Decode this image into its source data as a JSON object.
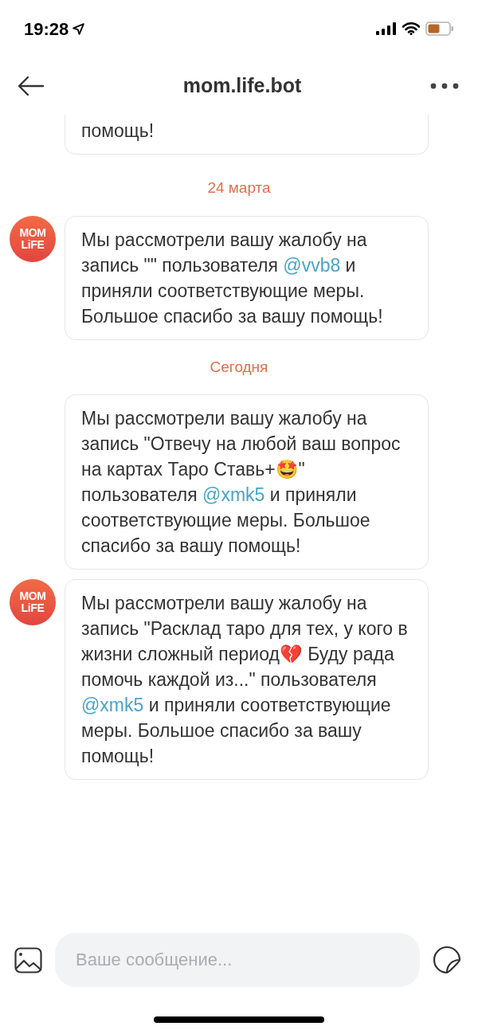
{
  "status_bar": {
    "time": "19:28"
  },
  "header": {
    "title": "mom.life.bot"
  },
  "feed": [
    {
      "kind": "message",
      "cut_top": true,
      "parts": [
        {
          "text": "помощь!",
          "mention": false
        }
      ]
    },
    {
      "kind": "date",
      "text": "24 марта"
    },
    {
      "kind": "message",
      "avatar": {
        "lines": [
          "MOM",
          "LiFE"
        ]
      },
      "parts": [
        {
          "text": "Мы рассмотрели вашу жалобу на запись \"\" пользователя ",
          "mention": false
        },
        {
          "text": "@vvb8",
          "mention": true
        },
        {
          "text": " и приняли соответствующие меры. Большое спасибо за вашу помощь!",
          "mention": false
        }
      ]
    },
    {
      "kind": "date",
      "text": "Сегодня"
    },
    {
      "kind": "message",
      "parts": [
        {
          "text": "Мы рассмотрели вашу жалобу на запись \"Отвечу на любой ваш вопрос на картах Таро Ставь+🤩\" пользователя ",
          "mention": false
        },
        {
          "text": "@xmk5",
          "mention": true
        },
        {
          "text": " и приняли соответствующие меры. Большое спасибо за вашу помощь!",
          "mention": false
        }
      ]
    },
    {
      "kind": "message",
      "avatar": {
        "lines": [
          "MOM",
          "LiFE"
        ]
      },
      "parts": [
        {
          "text": "Мы рассмотрели вашу жалобу на запись \"Расклад таро для тех, у кого в жизни сложный период💔 Буду рада помочь каждой из...\" пользователя ",
          "mention": false
        },
        {
          "text": "@xmk5",
          "mention": true
        },
        {
          "text": " и приняли соответствующие меры. Большое спасибо за вашу помощь!",
          "mention": false
        }
      ]
    }
  ],
  "composer": {
    "placeholder": "Ваше сообщение..."
  }
}
